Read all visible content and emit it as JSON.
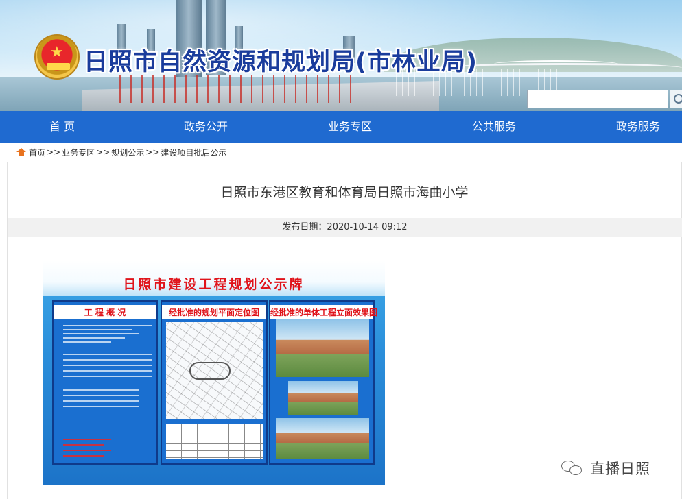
{
  "header": {
    "site_title": "日照市自然资源和规划局(市林业局)",
    "emblem_icon": "national-emblem-icon",
    "search": {
      "placeholder": "",
      "value": ""
    }
  },
  "nav": {
    "background": "#1f6ad0",
    "items": [
      {
        "label": "首 页"
      },
      {
        "label": "政务公开"
      },
      {
        "label": "业务专区"
      },
      {
        "label": "公共服务"
      },
      {
        "label": "政务服务"
      }
    ]
  },
  "breadcrumb": {
    "icon": "home-icon",
    "items": [
      "首页",
      "业务专区",
      "规划公示",
      "建设项目批后公示"
    ],
    "separator": ">>"
  },
  "article": {
    "title": "日照市东港区教育和体育局日照市海曲小学",
    "publish_label": "发布日期：",
    "publish_date": "2020-10-14 09:12"
  },
  "board": {
    "title": "日照市建设工程规划公示牌",
    "columns": [
      {
        "title": "工 程 概 况"
      },
      {
        "title": "经批准的规划平面定位图"
      },
      {
        "title": "经批准的单体工程立面效果图"
      }
    ]
  },
  "watermark": {
    "icon": "wechat-icon",
    "text": "直播日照"
  }
}
